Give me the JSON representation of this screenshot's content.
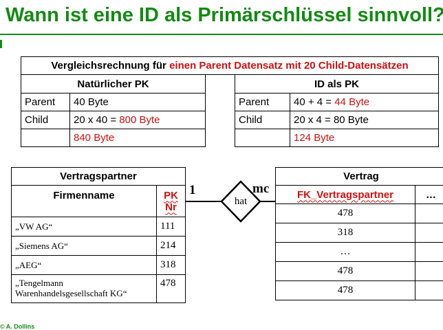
{
  "title": "Wann ist eine ID als Primärschlüssel sinnvoll?",
  "comparison": {
    "heading_prefix": "Vergleichsrechnung für ",
    "heading_highlight": "einen Parent Datensatz mit 20 Child-Datensätzen",
    "natural": {
      "header": "Natürlicher PK",
      "rows": [
        {
          "label": "Parent",
          "value": "40 Byte"
        },
        {
          "label": "Child",
          "value_prefix": "20 x 40 = ",
          "value_highlight": "800 Byte"
        },
        {
          "label": "",
          "value_highlight": "840 Byte"
        }
      ]
    },
    "id": {
      "header": "ID als PK",
      "rows": [
        {
          "label": "Parent",
          "value_prefix": "40 + 4 = ",
          "value_highlight": "44 Byte"
        },
        {
          "label": "Child",
          "value": "20 x 4 = 80 Byte"
        },
        {
          "label": "",
          "value_highlight": "124 Byte"
        }
      ]
    }
  },
  "vertragspartner": {
    "title": "Vertragspartner",
    "col_firmenname": "Firmenname",
    "col_pk_line1": "PK",
    "col_pk_line2": "Nr",
    "rows": [
      {
        "name": "„VW AG“",
        "nr": "111"
      },
      {
        "name": "„Siemens AG“",
        "nr": "214"
      },
      {
        "name": "„AEG“",
        "nr": "318"
      },
      {
        "name": "„Tengelmann Warenhandelsgesellschaft KG“",
        "nr": "478"
      }
    ]
  },
  "relationship": {
    "label": "hat",
    "left_cardinality": "1",
    "right_cardinality": "mc"
  },
  "vertrag": {
    "title": "Vertrag",
    "col_fk": "FK_Vertragspartner",
    "col_more": "…",
    "rows": [
      "478",
      "318",
      "…",
      "478",
      "478"
    ]
  },
  "footer": "© A. Dollins"
}
